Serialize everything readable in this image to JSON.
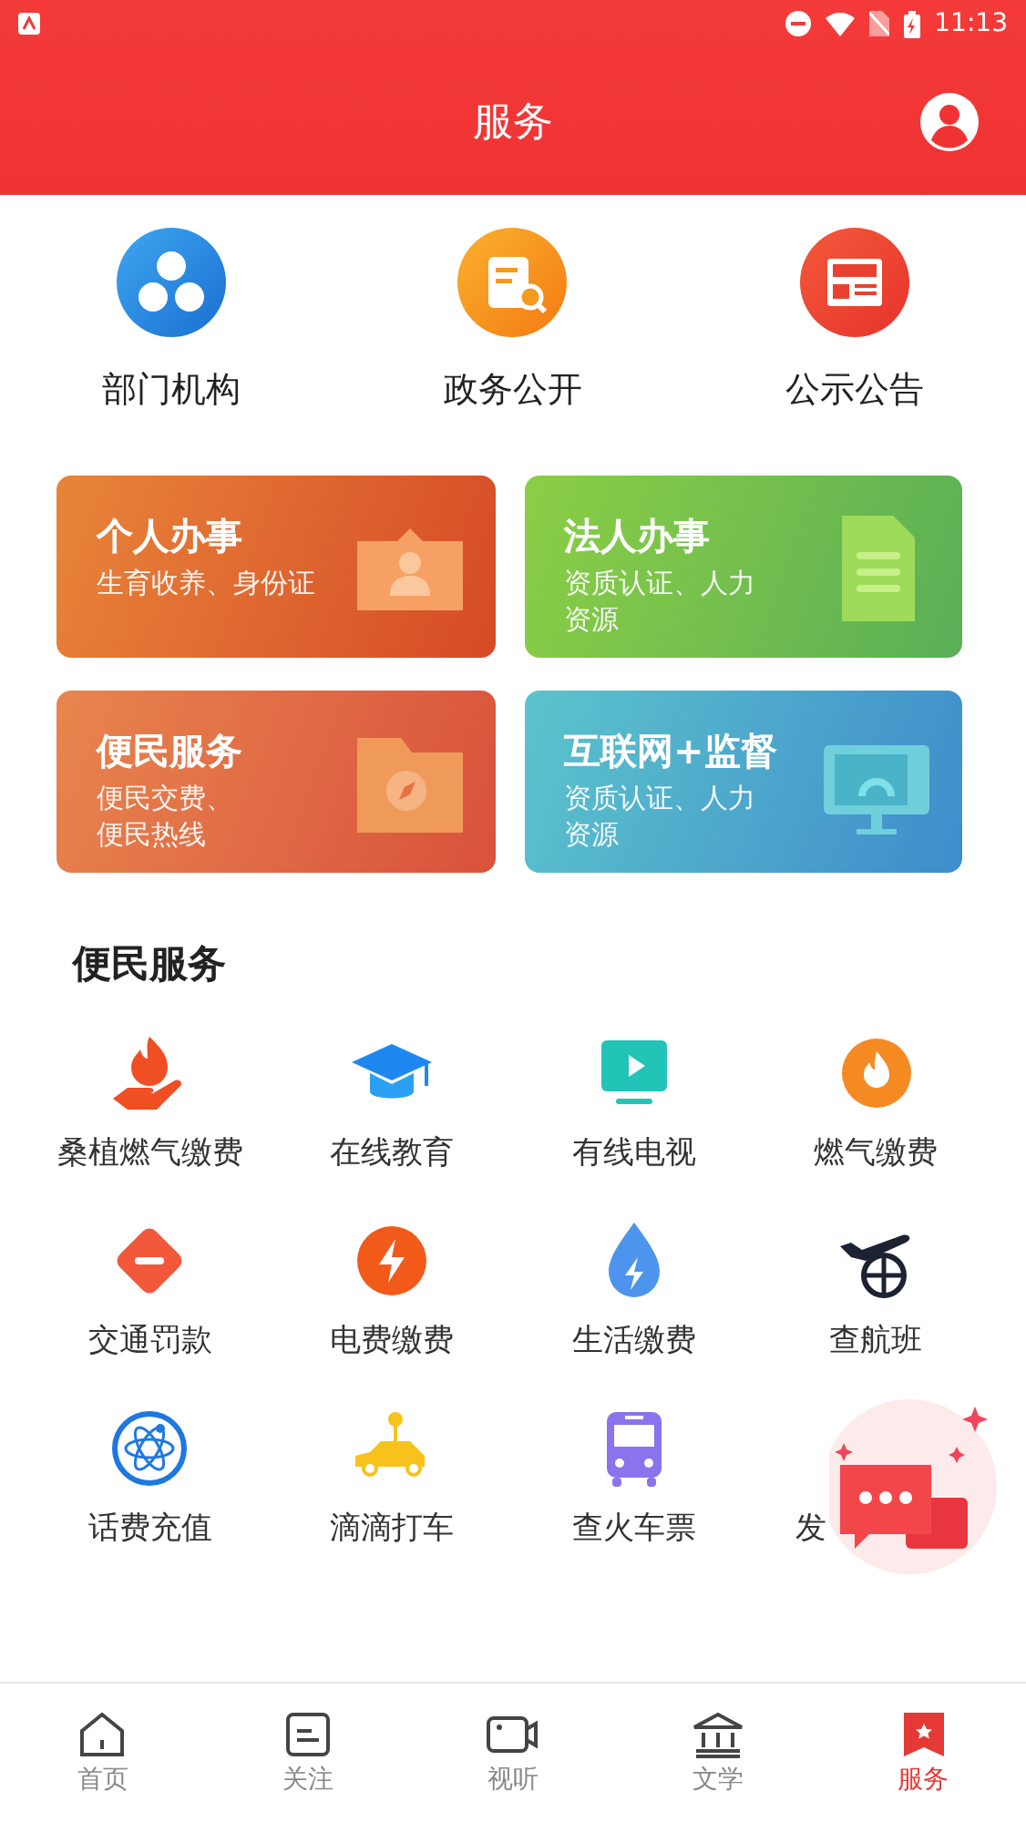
{
  "status_bar": {
    "time": "11:13"
  },
  "header": {
    "title": "服务"
  },
  "quick_links": [
    {
      "label": "部门机构",
      "kind": "org"
    },
    {
      "label": "政务公开",
      "kind": "clipboard"
    },
    {
      "label": "公示公告",
      "kind": "news"
    }
  ],
  "cards": [
    {
      "title": "个人办事",
      "subtitle": "生育收养、身份证",
      "kind": "person"
    },
    {
      "title": "法人办事",
      "subtitle": "资质认证、人力资源",
      "kind": "document"
    },
    {
      "title": "便民服务",
      "subtitle": "便民交费、便民热线",
      "kind": "folder"
    },
    {
      "title": "互联网+监督",
      "subtitle": "资质认证、人力资源",
      "kind": "monitor"
    }
  ],
  "section": {
    "title": "便民服务"
  },
  "services": [
    {
      "label": "桑植燃气缴费",
      "kind": "flame-hand"
    },
    {
      "label": "在线教育",
      "kind": "cap"
    },
    {
      "label": "有线电视",
      "kind": "tv"
    },
    {
      "label": "燃气缴费",
      "kind": "flame"
    },
    {
      "label": "交通罚款",
      "kind": "minus"
    },
    {
      "label": "电费缴费",
      "kind": "bolt"
    },
    {
      "label": "生活缴费",
      "kind": "drop"
    },
    {
      "label": "查航班",
      "kind": "plane"
    },
    {
      "label": "话费充值",
      "kind": "atom"
    },
    {
      "label": "滴滴打车",
      "kind": "car"
    },
    {
      "label": "查火车票",
      "kind": "bus"
    },
    {
      "label": "发",
      "kind": "none",
      "partial": true
    }
  ],
  "tabs": [
    {
      "label": "首页",
      "kind": "home",
      "selected": false
    },
    {
      "label": "关注",
      "kind": "note",
      "selected": false
    },
    {
      "label": "视听",
      "kind": "camera",
      "selected": false
    },
    {
      "label": "文学",
      "kind": "bank",
      "selected": false
    },
    {
      "label": "服务",
      "kind": "flag",
      "selected": true
    }
  ]
}
